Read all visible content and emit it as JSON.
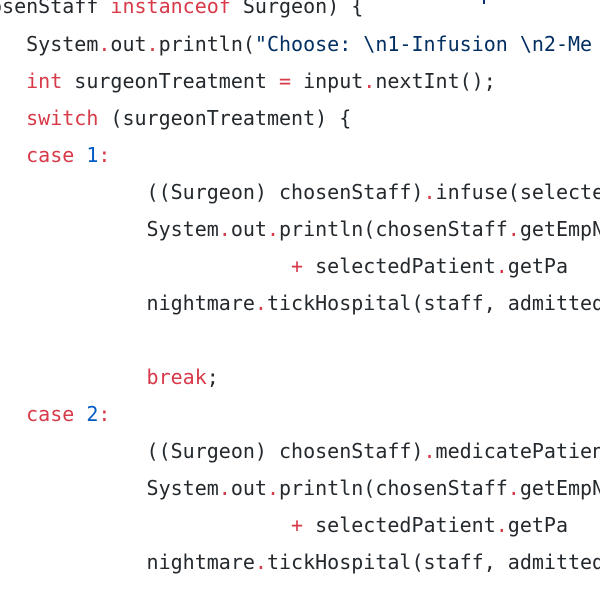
{
  "editor": {
    "lines": [
      [
        {
          "text": "osenStaff ",
          "kind": "plain"
        },
        {
          "text": "instanceof",
          "kind": "kw"
        },
        {
          "text": " Surgeon) {",
          "kind": "plain"
        }
      ],
      [
        {
          "text": "   System",
          "kind": "plain"
        },
        {
          "text": ".",
          "kind": "op"
        },
        {
          "text": "out",
          "kind": "plain"
        },
        {
          "text": ".",
          "kind": "op"
        },
        {
          "text": "println(",
          "kind": "plain"
        },
        {
          "text": "\"Choose: \\n1-Infusion \\n2-Me",
          "kind": "str"
        }
      ],
      [
        {
          "text": "   ",
          "kind": "plain"
        },
        {
          "text": "int",
          "kind": "kw"
        },
        {
          "text": " surgeonTreatment ",
          "kind": "plain"
        },
        {
          "text": "=",
          "kind": "op"
        },
        {
          "text": " input",
          "kind": "plain"
        },
        {
          "text": ".",
          "kind": "op"
        },
        {
          "text": "nextInt();",
          "kind": "plain"
        }
      ],
      [
        {
          "text": "   ",
          "kind": "plain"
        },
        {
          "text": "switch",
          "kind": "kw"
        },
        {
          "text": " (surgeonTreatment) {",
          "kind": "plain"
        }
      ],
      [
        {
          "text": "   ",
          "kind": "plain"
        },
        {
          "text": "case",
          "kind": "kw"
        },
        {
          "text": " ",
          "kind": "plain"
        },
        {
          "text": "1",
          "kind": "num"
        },
        {
          "text": ":",
          "kind": "op"
        }
      ],
      [
        {
          "text": "             ((Surgeon) chosenStaff)",
          "kind": "plain"
        },
        {
          "text": ".",
          "kind": "op"
        },
        {
          "text": "infuse(selecte",
          "kind": "plain"
        }
      ],
      [
        {
          "text": "             System",
          "kind": "plain"
        },
        {
          "text": ".",
          "kind": "op"
        },
        {
          "text": "out",
          "kind": "plain"
        },
        {
          "text": ".",
          "kind": "op"
        },
        {
          "text": "println(chosenStaff",
          "kind": "plain"
        },
        {
          "text": ".",
          "kind": "op"
        },
        {
          "text": "getEmpNa",
          "kind": "plain"
        }
      ],
      [
        {
          "text": "                         ",
          "kind": "plain"
        },
        {
          "text": "+",
          "kind": "op"
        },
        {
          "text": " selectedPatient",
          "kind": "plain"
        },
        {
          "text": ".",
          "kind": "op"
        },
        {
          "text": "getPa",
          "kind": "plain"
        }
      ],
      [
        {
          "text": "             nightmare",
          "kind": "plain"
        },
        {
          "text": ".",
          "kind": "op"
        },
        {
          "text": "tickHospital(staff, admitted",
          "kind": "plain"
        }
      ],
      [],
      [
        {
          "text": "             ",
          "kind": "plain"
        },
        {
          "text": "break",
          "kind": "kw"
        },
        {
          "text": ";",
          "kind": "plain"
        }
      ],
      [
        {
          "text": "   ",
          "kind": "plain"
        },
        {
          "text": "case",
          "kind": "kw"
        },
        {
          "text": " ",
          "kind": "plain"
        },
        {
          "text": "2",
          "kind": "num"
        },
        {
          "text": ":",
          "kind": "op"
        }
      ],
      [
        {
          "text": "             ((Surgeon) chosenStaff)",
          "kind": "plain"
        },
        {
          "text": ".",
          "kind": "op"
        },
        {
          "text": "medicatePatient",
          "kind": "plain"
        }
      ],
      [
        {
          "text": "             System",
          "kind": "plain"
        },
        {
          "text": ".",
          "kind": "op"
        },
        {
          "text": "out",
          "kind": "plain"
        },
        {
          "text": ".",
          "kind": "op"
        },
        {
          "text": "println(chosenStaff",
          "kind": "plain"
        },
        {
          "text": ".",
          "kind": "op"
        },
        {
          "text": "getEmpNa",
          "kind": "plain"
        }
      ],
      [
        {
          "text": "                         ",
          "kind": "plain"
        },
        {
          "text": "+",
          "kind": "op"
        },
        {
          "text": " selectedPatient",
          "kind": "plain"
        },
        {
          "text": ".",
          "kind": "op"
        },
        {
          "text": "getPa",
          "kind": "plain"
        }
      ],
      [
        {
          "text": "             nightmare",
          "kind": "plain"
        },
        {
          "text": ".",
          "kind": "op"
        },
        {
          "text": "tickHospital(staff, admitted",
          "kind": "plain"
        }
      ]
    ]
  },
  "colors": {
    "background": "#ffffff",
    "plain": "#24292e",
    "keyword": "#d73a49",
    "operator": "#d73a49",
    "string": "#032f62",
    "number": "#005cc5"
  }
}
